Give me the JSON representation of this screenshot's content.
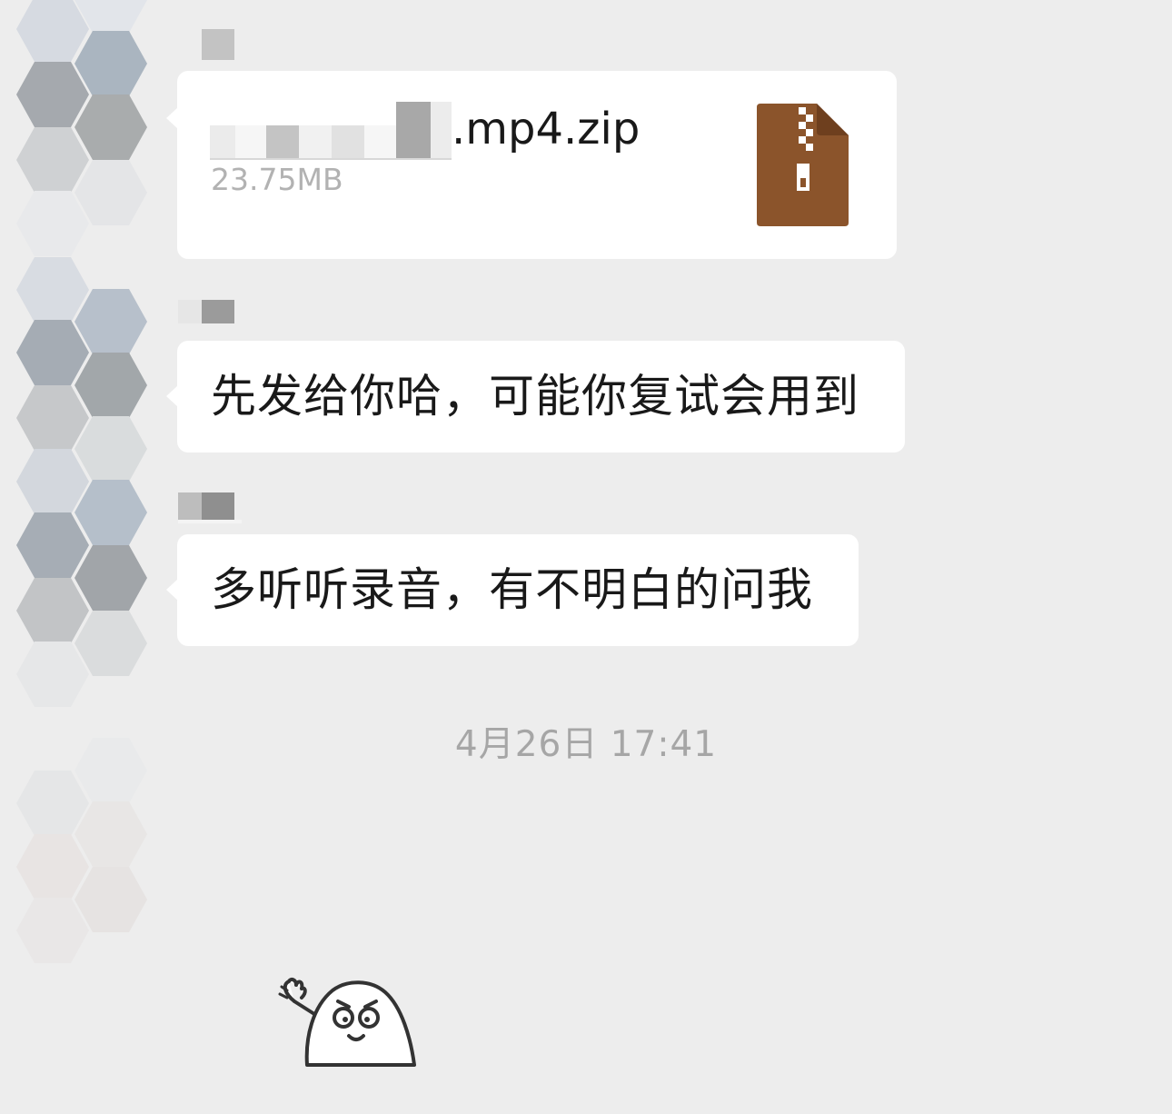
{
  "messages": [
    {
      "type": "file",
      "file_name_suffix": ".mp4.zip",
      "file_size": "23.75MB",
      "file_icon": "zip-archive-icon"
    },
    {
      "type": "text",
      "text": "先发给你哈，可能你复试会用到"
    },
    {
      "type": "text",
      "text": "多听听录音，有不明白的问我"
    }
  ],
  "timestamp": "4月26日 17:41",
  "sticker": {
    "icon": "waving-ghost-sticker"
  },
  "colors": {
    "background": "#ededed",
    "bubble": "#ffffff",
    "text": "#191919",
    "secondary_text": "#b2b2b2",
    "zip_icon": "#8b542b"
  }
}
